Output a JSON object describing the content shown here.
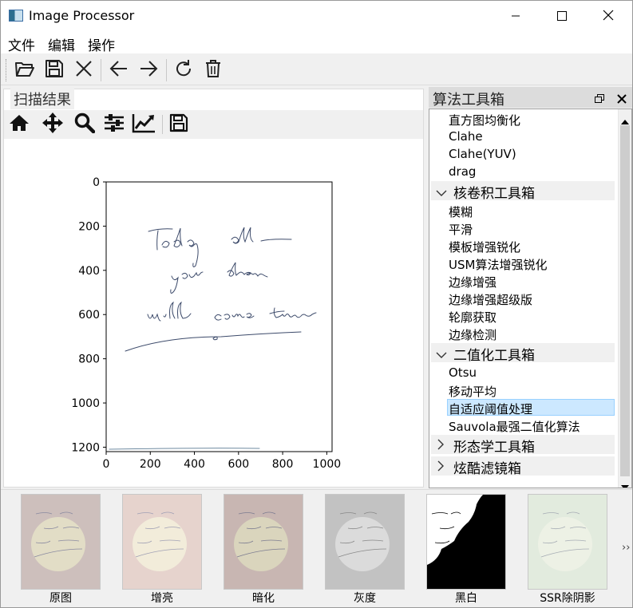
{
  "window": {
    "title": "Image Processor",
    "controls": [
      "minimize-icon",
      "maximize-icon",
      "close-icon"
    ]
  },
  "menubar": {
    "items": [
      "文件",
      "编辑",
      "操作"
    ]
  },
  "toolbar": {
    "buttons": [
      "open-folder-icon",
      "save-icon",
      "close-icon",
      "back-arrow-icon",
      "forward-arrow-icon",
      "refresh-icon",
      "trash-icon"
    ]
  },
  "scan_panel": {
    "title": "扫描结果",
    "mpl_tools": [
      "home-icon",
      "pan-icon",
      "zoom-icon",
      "configure-icon",
      "edit-axis-icon",
      "save-icon"
    ]
  },
  "chart_data": {
    "type": "image",
    "xticks": [
      "0",
      "200",
      "400",
      "600",
      "800",
      "1000"
    ],
    "yticks": [
      "0",
      "200",
      "400",
      "600",
      "800",
      "1000",
      "1200"
    ],
    "xlim": [
      0,
      1024
    ],
    "ylim": [
      1220,
      0
    ],
    "handwriting": [
      "Today all",
      "your dream",
      "will come true"
    ]
  },
  "dock": {
    "title": "算法工具箱",
    "tree": {
      "top_items": [
        "直方图均衡化",
        "Clahe",
        "Clahe(YUV)",
        "drag"
      ],
      "groups": [
        {
          "label": "核卷积工具箱",
          "expanded": true,
          "items": [
            "模糊",
            "平滑",
            "模板增强锐化",
            "USM算法增强锐化",
            "边缘增强",
            "边缘增强超级版",
            "轮廓获取",
            "边缘检测"
          ]
        },
        {
          "label": "二值化工具箱",
          "expanded": true,
          "items": [
            "Otsu",
            "移动平均",
            "自适应阈值处理",
            "Sauvola最强二值化算法"
          ]
        },
        {
          "label": "形态学工具箱",
          "expanded": false,
          "items": []
        },
        {
          "label": "炫酷滤镜箱",
          "expanded": false,
          "items": []
        }
      ],
      "selected": "自适应阈值处理"
    }
  },
  "thumbnails": {
    "items": [
      "原图",
      "增亮",
      "暗化",
      "灰度",
      "黑白",
      "SSR除阴影"
    ],
    "more": "››"
  }
}
